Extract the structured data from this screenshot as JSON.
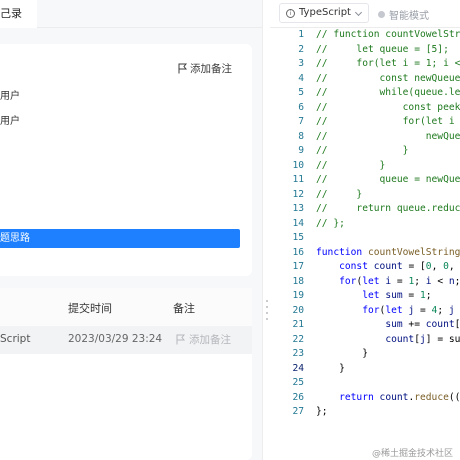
{
  "left": {
    "tab_label": "己录",
    "note_label": "添加备注",
    "user_lines": [
      "用户",
      "用户"
    ],
    "idea_bar": "题思路",
    "table": {
      "headers": [
        "提交时间",
        "备注"
      ],
      "row": {
        "lang": "Script",
        "time": "2023/03/29 23:24",
        "note": "添加备注"
      }
    }
  },
  "right": {
    "language": "TypeScript",
    "smart_mode": "智能模式",
    "code_lines": [
      {
        "n": "1",
        "t": "// function countVowelStr"
      },
      {
        "n": "2",
        "t": "//     let queue = [5];"
      },
      {
        "n": "3",
        "t": "//     for(let i = 1; i <"
      },
      {
        "n": "4",
        "t": "//         const newQueue"
      },
      {
        "n": "5",
        "t": "//         while(queue.le"
      },
      {
        "n": "6",
        "t": "//             const peek"
      },
      {
        "n": "7",
        "t": "//             for(let i "
      },
      {
        "n": "8",
        "t": "//                 newQue"
      },
      {
        "n": "9",
        "t": "//             }"
      },
      {
        "n": "10",
        "t": "//         }"
      },
      {
        "n": "11",
        "t": "//         queue = newQue"
      },
      {
        "n": "12",
        "t": "//     }"
      },
      {
        "n": "13",
        "t": "//     return queue.reduc"
      },
      {
        "n": "14",
        "t": "// };"
      },
      {
        "n": "15",
        "t": ""
      },
      {
        "n": "16",
        "t": "function countVowelString"
      },
      {
        "n": "17",
        "t": "    const count = [0, 0, "
      },
      {
        "n": "18",
        "t": "    for(let i = 1; i < n;"
      },
      {
        "n": "19",
        "t": "        let sum = 1;"
      },
      {
        "n": "20",
        "t": "        for(let j = 4; j "
      },
      {
        "n": "21",
        "t": "            sum += count["
      },
      {
        "n": "22",
        "t": "            count[j] = su"
      },
      {
        "n": "23",
        "t": "        }"
      },
      {
        "n": "24",
        "t": "    }"
      },
      {
        "n": "25",
        "t": ""
      },
      {
        "n": "26",
        "t": "    return count.reduce(("
      },
      {
        "n": "27",
        "t": "};"
      }
    ]
  },
  "watermark": "@稀土掘金技术社区",
  "colors": {
    "accent": "#1e80ff",
    "comment": "#1f7a1f",
    "keyword": "#0000ff",
    "line_number": "#237893"
  }
}
